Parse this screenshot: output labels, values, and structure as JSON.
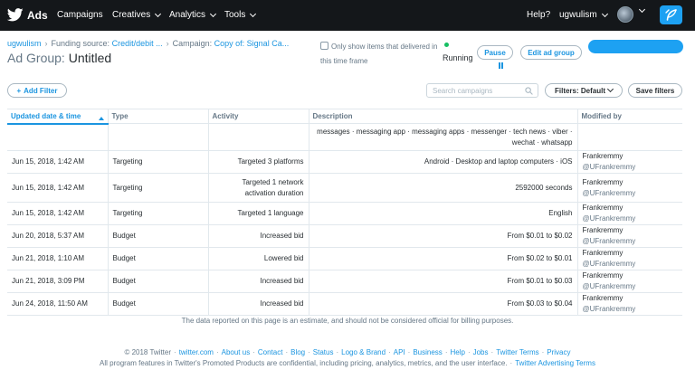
{
  "nav": {
    "brand": "Ads",
    "items": [
      {
        "label": "Campaigns"
      },
      {
        "label": "Creatives"
      },
      {
        "label": "Analytics"
      },
      {
        "label": "Tools"
      }
    ],
    "help": "Help?",
    "account": "ugwulism"
  },
  "breadcrumb": {
    "account": "ugwulism",
    "funding_prefix": "Funding source:",
    "funding_value": "Credit/debit ...",
    "campaign_prefix": "Campaign:",
    "campaign_value": "Copy of: Signal Ca..."
  },
  "adgroup": {
    "prefix": "Ad Group:",
    "name": "Untitled"
  },
  "toggle": {
    "label": "Only show items that delivered in this time frame",
    "checked": false
  },
  "status": {
    "text": "Running",
    "color": "#17bf63"
  },
  "buttons": {
    "pause": "Pause",
    "edit": "Edit ad group",
    "add_filter": "Add Filter",
    "filters": "Filters: Default",
    "save_filters": "Save filters"
  },
  "search": {
    "placeholder": "Search campaigns",
    "value": ""
  },
  "table": {
    "columns": [
      "Updated date & time",
      "Type",
      "Activity",
      "Description",
      "Modified by"
    ],
    "sorted_column": "Updated date & time",
    "first_row_description": "messages · messaging app · messaging apps · messenger · tech news · viber · wechat · whatsapp",
    "rows": [
      {
        "date": "Jun 15, 2018, 1:42 AM",
        "type": "Targeting",
        "activity": "Targeted 3 platforms",
        "description": "Android · Desktop and laptop computers · iOS",
        "name": "Frankremmy",
        "handle": "@UFrankremmy"
      },
      {
        "date": "Jun 15, 2018, 1:42 AM",
        "type": "Targeting",
        "activity": "Targeted 1 network activation duration",
        "description": "2592000 seconds",
        "name": "Frankremmy",
        "handle": "@UFrankremmy"
      },
      {
        "date": "Jun 15, 2018, 1:42 AM",
        "type": "Targeting",
        "activity": "Targeted 1 language",
        "description": "English",
        "name": "Frankremmy",
        "handle": "@UFrankremmy"
      },
      {
        "date": "Jun 20, 2018, 5:37 AM",
        "type": "Budget",
        "activity": "Increased bid",
        "description": "From $0.01 to $0.02",
        "name": "Frankremmy",
        "handle": "@UFrankremmy"
      },
      {
        "date": "Jun 21, 2018, 1:10 AM",
        "type": "Budget",
        "activity": "Lowered bid",
        "description": "From $0.02 to $0.01",
        "name": "Frankremmy",
        "handle": "@UFrankremmy"
      },
      {
        "date": "Jun 21, 2018, 3:09 PM",
        "type": "Budget",
        "activity": "Increased bid",
        "description": "From $0.01 to $0.03",
        "name": "Frankremmy",
        "handle": "@UFrankremmy"
      },
      {
        "date": "Jun 24, 2018, 11:50 AM",
        "type": "Budget",
        "activity": "Increased bid",
        "description": "From $0.03 to $0.04",
        "name": "Frankremmy",
        "handle": "@UFrankremmy"
      }
    ]
  },
  "footer": {
    "disclaimer": "The data reported on this page is an estimate, and should not be considered official for billing purposes.",
    "copyright": "© 2018 Twitter",
    "links": [
      "twitter.com",
      "About us",
      "Contact",
      "Blog",
      "Status",
      "Logo & Brand",
      "API",
      "Business",
      "Help",
      "Jobs",
      "Twitter Terms",
      "Privacy"
    ],
    "confidential": "All program features in Twitter's Promoted Products are confidential, including pricing, analytics, metrics, and the user interface.",
    "advertising_terms": "Twitter Advertising Terms"
  },
  "colors": {
    "nav_bg": "#14171a",
    "accent": "#1da1f2",
    "link": "#1b95e0"
  },
  "icons": [
    "twitter-bird-icon",
    "chevron-down-icon",
    "avatar",
    "compose-feather-icon",
    "plus-icon",
    "search-icon",
    "sort-asc-icon",
    "pause-icon",
    "checkbox-icon"
  ]
}
